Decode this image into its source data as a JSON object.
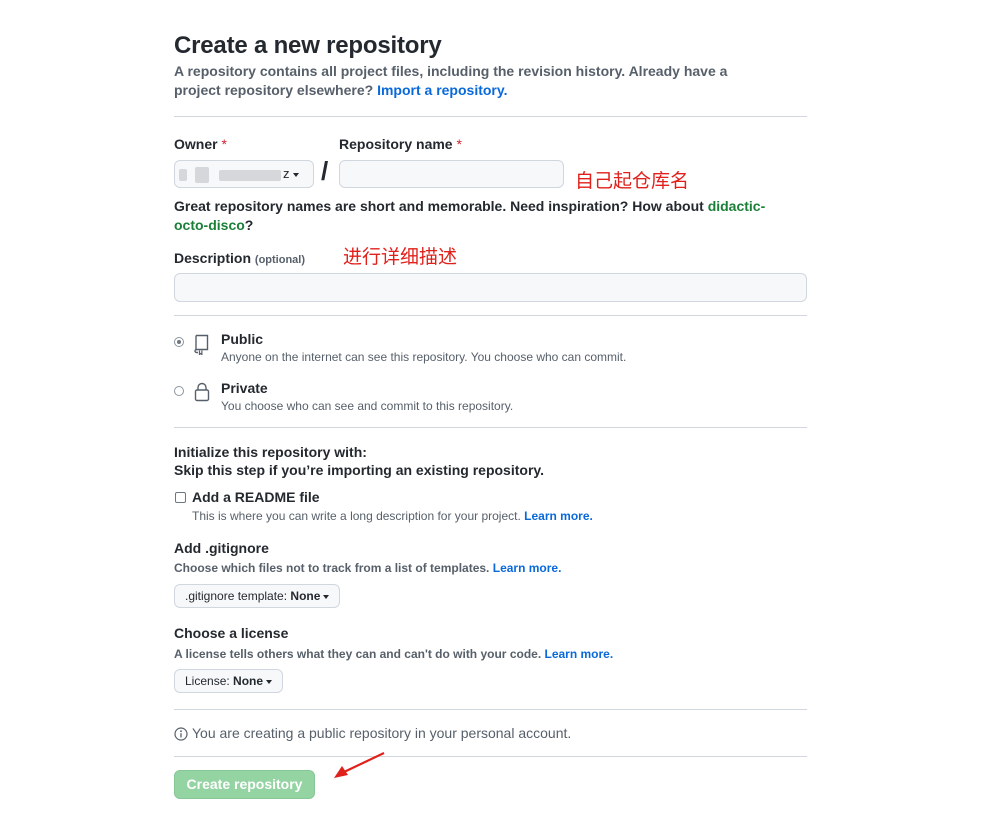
{
  "header": {
    "title": "Create a new repository",
    "subtitle": "A repository contains all project files, including the revision history. Already have a project repository elsewhere?",
    "import_link": "Import a repository."
  },
  "owner": {
    "label": "Owner",
    "required_mark": "*",
    "value_visible_suffix": "z"
  },
  "slash": "/",
  "repo_name": {
    "label": "Repository name",
    "required_mark": "*",
    "value": "",
    "annotation": "自己起仓库名"
  },
  "name_hint": {
    "text": "Great repository names are short and memorable. Need inspiration? How about",
    "suggestion": "didactic-octo-disco",
    "end": "?"
  },
  "description": {
    "label": "Description",
    "optional": "(optional)",
    "value": "",
    "annotation": "进行详细描述"
  },
  "visibility": {
    "options": [
      {
        "title": "Public",
        "desc": "Anyone on the internet can see this repository. You choose who can commit.",
        "selected": true,
        "icon": "repo-icon"
      },
      {
        "title": "Private",
        "desc": "You choose who can see and commit to this repository.",
        "selected": false,
        "icon": "lock-icon"
      }
    ]
  },
  "initialize": {
    "heading": "Initialize this repository with:",
    "subheading": "Skip this step if you’re importing an existing repository.",
    "readme": {
      "label": "Add a README file",
      "desc": "This is where you can write a long description for your project.",
      "learn_more": "Learn more.",
      "checked": false
    }
  },
  "gitignore": {
    "heading": "Add .gitignore",
    "desc": "Choose which files not to track from a list of templates.",
    "learn_more": "Learn more.",
    "button_prefix": ".gitignore template:",
    "button_value": "None"
  },
  "license": {
    "heading": "Choose a license",
    "desc": "A license tells others what they can and can't do with your code.",
    "learn_more": "Learn more.",
    "button_prefix": "License:",
    "button_value": "None"
  },
  "notice": {
    "text": "You are creating a public repository in your personal account.",
    "icon": "info-icon"
  },
  "create_button": "Create repository",
  "colors": {
    "link": "#0969da",
    "suggestion": "#1a7f37",
    "annotation": "#e0201b",
    "create_button_bg": "#94d3a2",
    "required": "#cf222e"
  }
}
